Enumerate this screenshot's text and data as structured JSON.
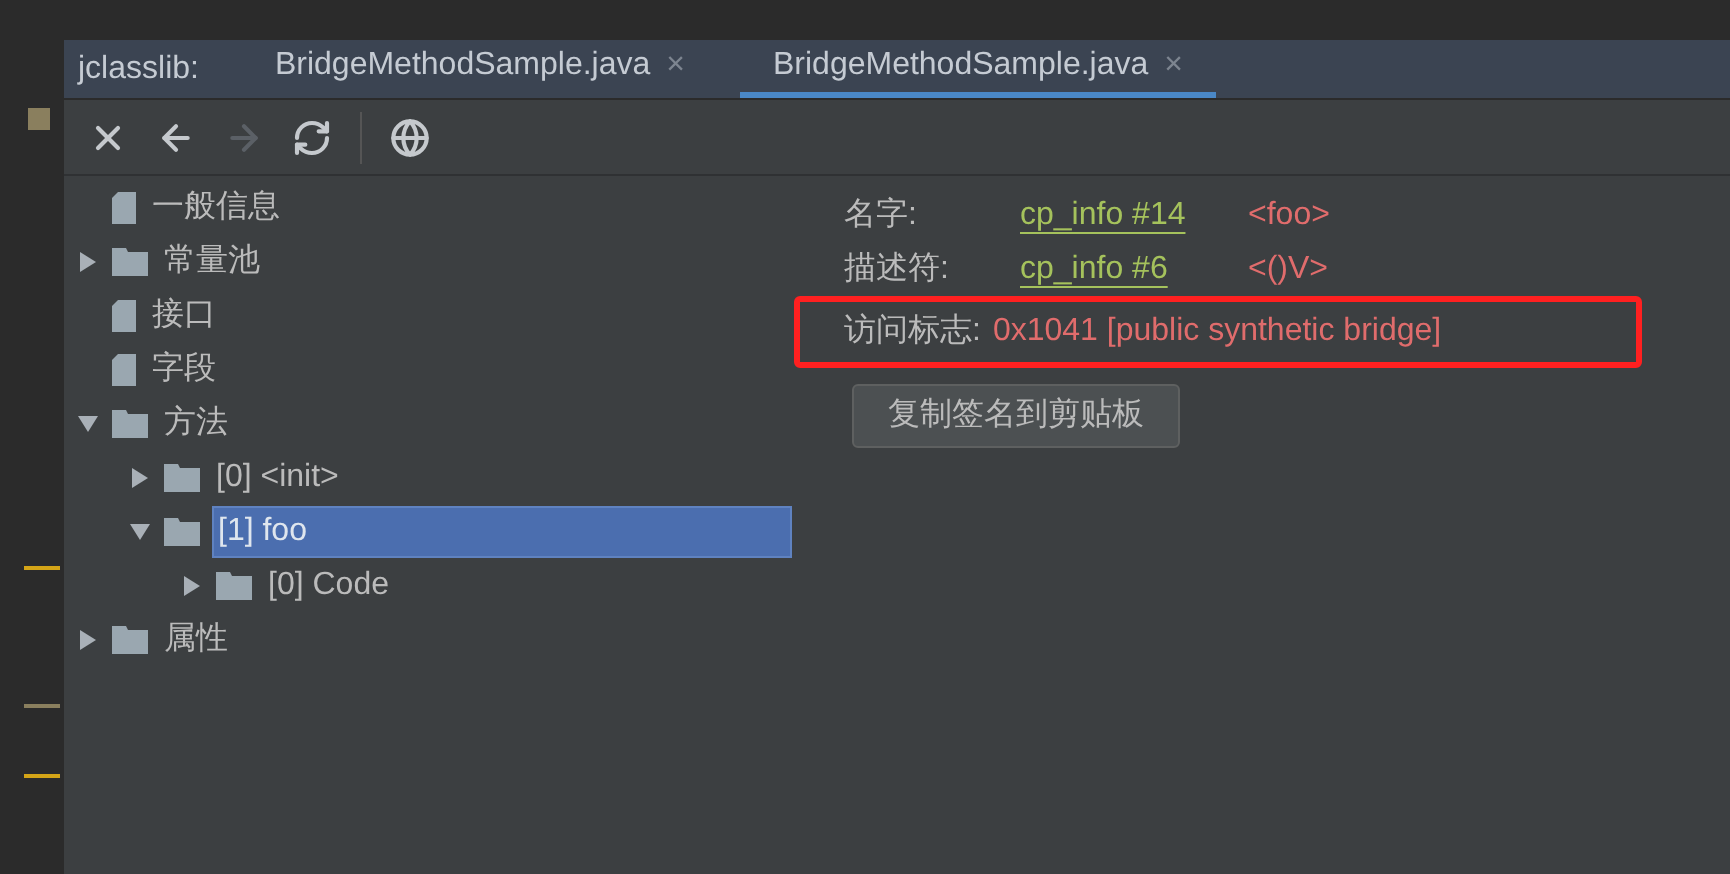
{
  "tab_bar": {
    "prefix": "jclasslib:",
    "tabs": [
      {
        "label": "BridgeMethodSample.java",
        "close": "×",
        "selected": false
      },
      {
        "label": "BridgeMethodSample.java",
        "close": "×",
        "selected": true
      }
    ]
  },
  "toolbar": [
    {
      "kind": "close",
      "disabled": false
    },
    {
      "kind": "back",
      "disabled": false
    },
    {
      "kind": "forward",
      "disabled": true
    },
    {
      "kind": "refresh",
      "disabled": false
    },
    {
      "kind": "web",
      "disabled": false
    }
  ],
  "tree": [
    {
      "label": "一般信息",
      "kind": "file",
      "selected": false
    },
    {
      "label": "常量池",
      "kind": "folder",
      "expanded": false,
      "selected": false
    },
    {
      "label": "接口",
      "kind": "file",
      "selected": false
    },
    {
      "label": "字段",
      "kind": "file",
      "selected": false
    },
    {
      "label": "方法",
      "kind": "folder",
      "expanded": true,
      "selected": false,
      "children": [
        {
          "label": "[0] <init>",
          "kind": "folder",
          "expanded": false,
          "selected": false
        },
        {
          "label": "[1] foo",
          "kind": "folder",
          "expanded": true,
          "selected": true,
          "children": [
            {
              "label": "[0] Code",
              "kind": "folder",
              "expanded": false,
              "selected": false
            }
          ]
        }
      ]
    },
    {
      "label": "属性",
      "kind": "folder",
      "expanded": false,
      "selected": false
    }
  ],
  "details": {
    "fields": [
      {
        "label": "名字:",
        "link": "cp_info #14",
        "value": "<foo>"
      },
      {
        "label": "描述符:",
        "link": "cp_info #6",
        "value": "<()V>"
      }
    ],
    "access": {
      "label": "访问标志:",
      "value": "0x1041 [public synthetic bridge]",
      "highlighted": true
    },
    "button": "复制签名到剪贴板"
  }
}
